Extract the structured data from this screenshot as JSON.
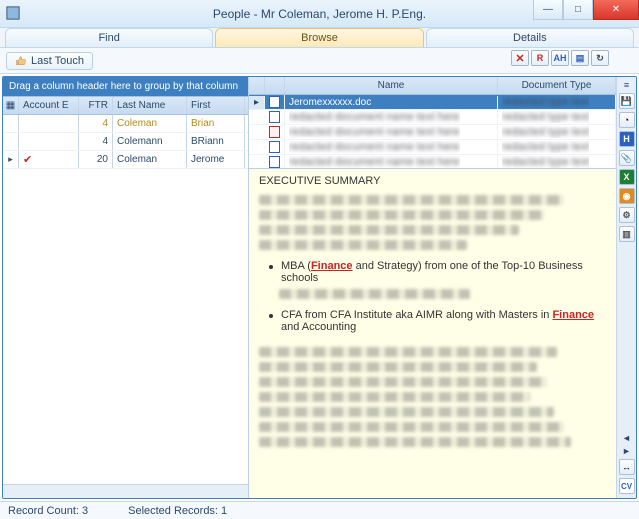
{
  "window": {
    "title": "People - Mr Coleman, Jerome H. P.Eng.",
    "min": "—",
    "max": "□",
    "close": "✕"
  },
  "tabs": {
    "find": "Find",
    "browse": "Browse",
    "details": "Details"
  },
  "toolbar": {
    "last_touch": "Last Touch",
    "btn_x": "✕",
    "btn_r": "R",
    "btn_ah": "AH",
    "btn_doc": "▤",
    "btn_ref": "↻"
  },
  "left": {
    "group_hint": "Drag a column header here to group by that column",
    "cols": {
      "acc": "Account E",
      "ftr": "FTR",
      "ln": "Last Name",
      "fn": "First"
    },
    "rows": [
      {
        "ftr": "4",
        "ln": "Coleman",
        "fn": "Brian",
        "sel": true
      },
      {
        "ftr": "4",
        "ln": "Colemann",
        "fn": "BRiann"
      },
      {
        "ftr": "20",
        "ln": "Coleman",
        "fn": "Jerome",
        "marked": true,
        "ptr": true
      }
    ]
  },
  "docs": {
    "cols": {
      "name": "Name",
      "type": "Document Type"
    },
    "rows": [
      {
        "ico": "word",
        "name": "Jeromexxxxxx.doc",
        "type": "blurred",
        "sel": true,
        "clear": true
      },
      {
        "ico": "word",
        "name": "blurred",
        "type": "blurred"
      },
      {
        "ico": "pdf",
        "name": "blurred",
        "type": "blurred"
      },
      {
        "ico": "word",
        "name": "blurred",
        "type": "blurred"
      },
      {
        "ico": "word",
        "name": "blurred",
        "type": "blurred"
      }
    ]
  },
  "preview": {
    "title": "EXECUTIVE SUMMARY",
    "bullet1_pre": "MBA (",
    "bullet1_fin": "Finance",
    "bullet1_post": " and Strategy) from one of the Top-10 Business schools",
    "bullet2_pre": "CFA from CFA Institute aka AIMR along with Masters in ",
    "bullet2_fin": "Finance",
    "bullet2_post": " and Accounting"
  },
  "rail": {
    "cv": "CV"
  },
  "status": {
    "count": "Record Count: 3",
    "selected": "Selected Records: 1"
  }
}
